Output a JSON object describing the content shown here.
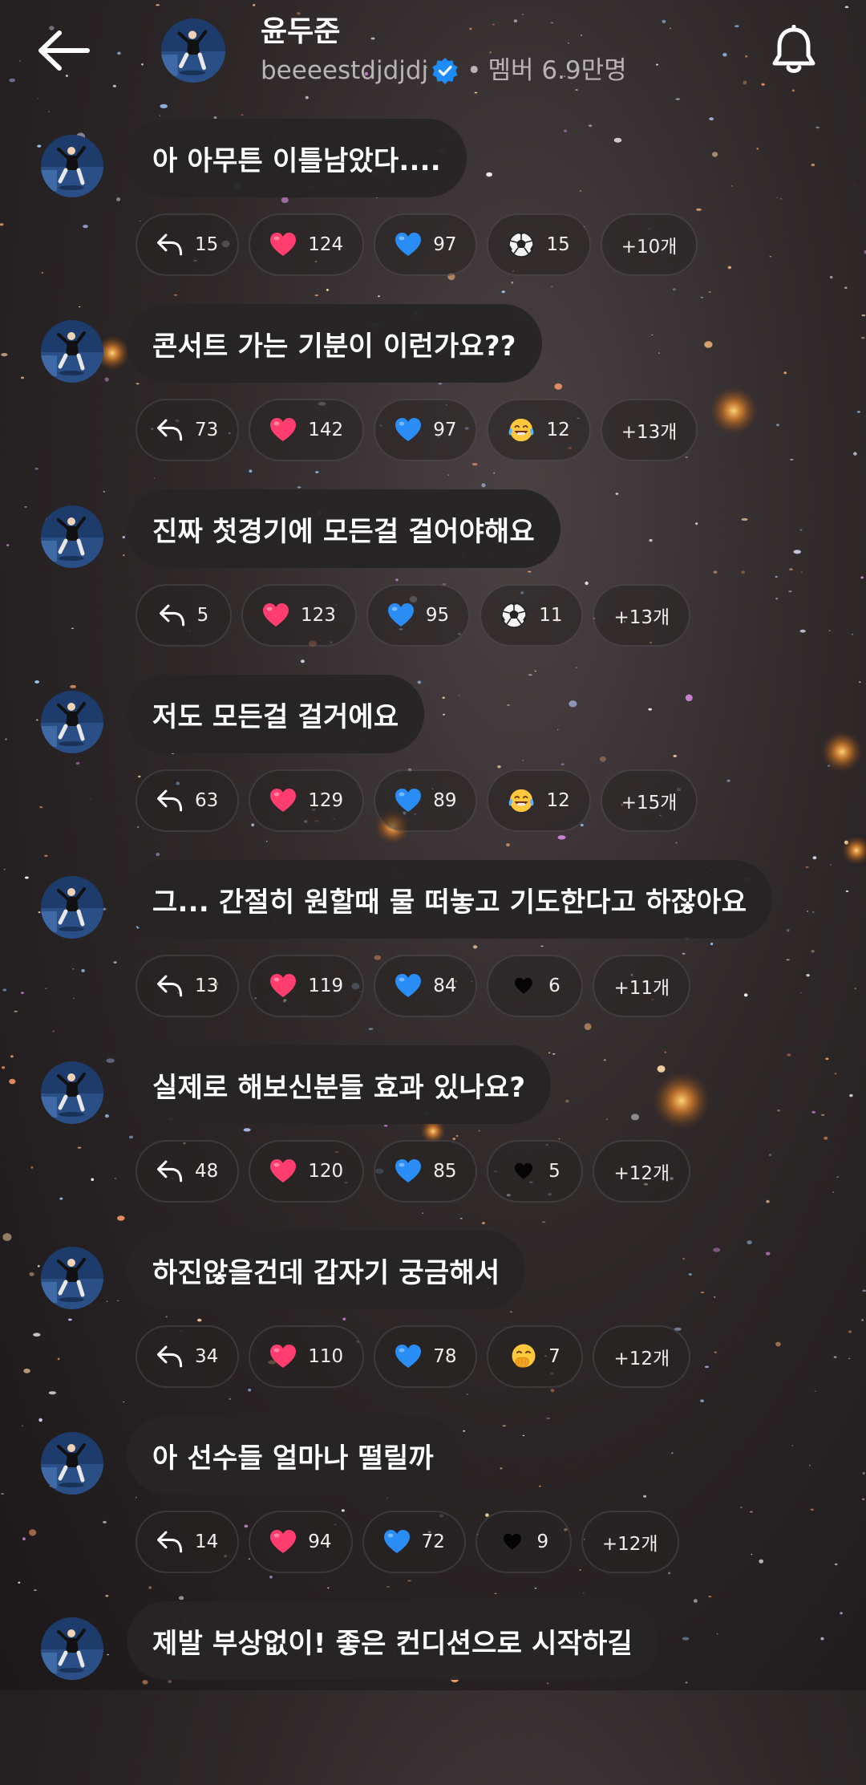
{
  "header": {
    "back_icon": "arrow-left-icon",
    "title": "윤두준",
    "handle": "beeeestdjdjdj",
    "separator": "•",
    "members": "멤버 6.9만명",
    "bell_icon": "bell-icon"
  },
  "colors": {
    "verified": "#1d8cf8",
    "heart": "#ff3d6e",
    "blue_heart": "#2a8df5"
  },
  "messages": [
    {
      "text": "아 아무튼 이틀남았다....",
      "reply": "15",
      "reactions": [
        {
          "icon": "red-heart-icon",
          "count": "124"
        },
        {
          "icon": "blue-heart-icon",
          "count": "97"
        },
        {
          "icon": "soccer-ball-icon",
          "count": "15"
        }
      ],
      "more": "+10개"
    },
    {
      "text": "콘서트 가는 기분이 이런가요??",
      "reply": "73",
      "reactions": [
        {
          "icon": "red-heart-icon",
          "count": "142"
        },
        {
          "icon": "blue-heart-icon",
          "count": "97"
        },
        {
          "icon": "tears-of-joy-icon",
          "count": "12"
        }
      ],
      "more": "+13개"
    },
    {
      "text": "진짜 첫경기에 모든걸 걸어야해요",
      "reply": "5",
      "reactions": [
        {
          "icon": "red-heart-icon",
          "count": "123"
        },
        {
          "icon": "blue-heart-icon",
          "count": "95"
        },
        {
          "icon": "soccer-ball-icon",
          "count": "11"
        }
      ],
      "more": "+13개"
    },
    {
      "text": "저도 모든걸 걸거에요",
      "reply": "63",
      "reactions": [
        {
          "icon": "red-heart-icon",
          "count": "129"
        },
        {
          "icon": "blue-heart-icon",
          "count": "89"
        },
        {
          "icon": "tears-of-joy-icon",
          "count": "12"
        }
      ],
      "more": "+15개"
    },
    {
      "text": "그... 간절히 원할때 물 떠놓고 기도한다고 하잖아요",
      "reply": "13",
      "reactions": [
        {
          "icon": "red-heart-icon",
          "count": "119"
        },
        {
          "icon": "blue-heart-icon",
          "count": "84"
        },
        {
          "icon": "black-heart-icon",
          "count": "6"
        }
      ],
      "more": "+11개"
    },
    {
      "text": "실제로 해보신분들 효과 있나요?",
      "reply": "48",
      "reactions": [
        {
          "icon": "red-heart-icon",
          "count": "120"
        },
        {
          "icon": "blue-heart-icon",
          "count": "85"
        },
        {
          "icon": "black-heart-icon",
          "count": "5"
        }
      ],
      "more": "+12개"
    },
    {
      "text": "하진않을건데 갑자기 궁금해서",
      "reply": "34",
      "reactions": [
        {
          "icon": "red-heart-icon",
          "count": "110"
        },
        {
          "icon": "blue-heart-icon",
          "count": "78"
        },
        {
          "icon": "hand-over-mouth-icon",
          "count": "7"
        }
      ],
      "more": "+12개"
    },
    {
      "text": "아 선수들 얼마나 떨릴까",
      "reply": "14",
      "reactions": [
        {
          "icon": "red-heart-icon",
          "count": "94"
        },
        {
          "icon": "blue-heart-icon",
          "count": "72"
        },
        {
          "icon": "black-heart-icon",
          "count": "9"
        }
      ],
      "more": "+12개"
    },
    {
      "text": "제발 부상없이! 좋은 컨디션으로 시작하길",
      "reply": null,
      "reactions": [],
      "more": null
    }
  ]
}
